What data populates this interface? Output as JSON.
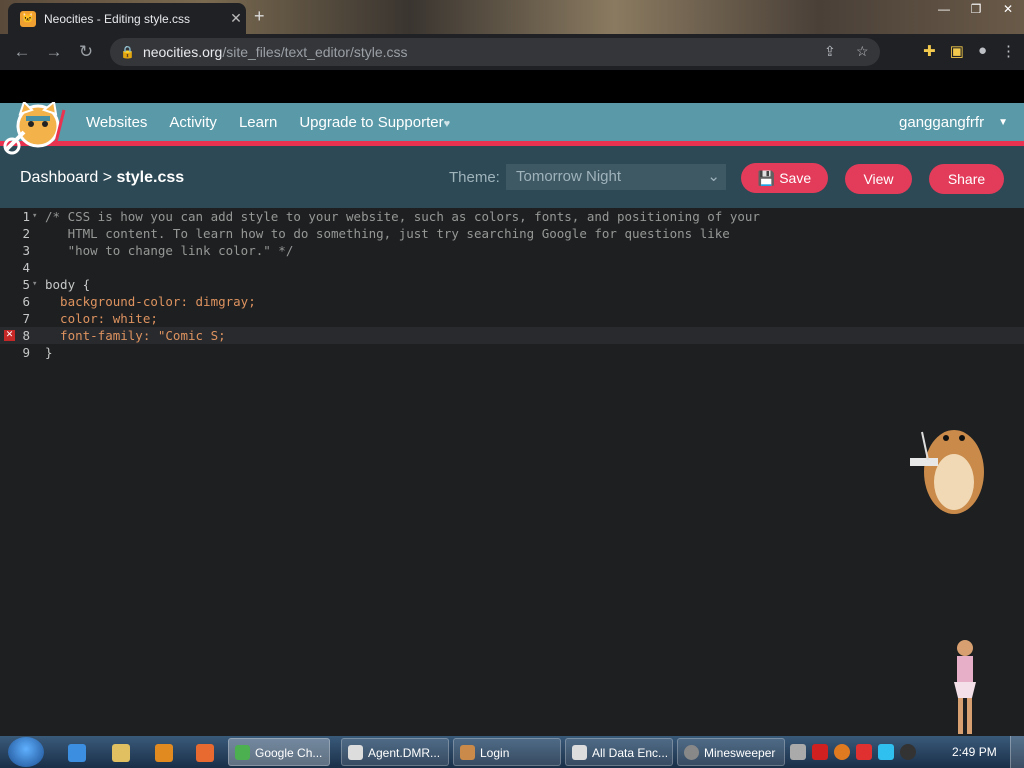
{
  "browser": {
    "tab_title": "Neocities - Editing style.css",
    "url_host": "neocities.org",
    "url_path": "/site_files/text_editor/style.css"
  },
  "site": {
    "nav": [
      "Websites",
      "Activity",
      "Learn",
      "Upgrade to Supporter"
    ],
    "username": "ganggangfrfr"
  },
  "editor": {
    "crumb_dashboard": "Dashboard",
    "crumb_sep": ">",
    "crumb_file": "style.css",
    "theme_label": "Theme:",
    "theme_value": "Tomorrow Night",
    "save_label": "Save",
    "view_label": "View",
    "share_label": "Share",
    "lines": [
      "/* CSS is how you can add style to your website, such as colors, fonts, and positioning of your",
      "   HTML content. To learn how to do something, just try searching Google for questions like",
      "   \"how to change link color.\" */",
      "",
      "body {",
      "  background-color: dimgray;",
      "  color: white;",
      "  font-family: \"Comic S;",
      "}"
    ]
  },
  "taskbar": {
    "items": [
      "Google Ch...",
      "Agent.DMR...",
      "Login",
      "All Data Enc...",
      "Minesweeper"
    ],
    "clock": "2:49 PM"
  },
  "colors": {
    "neocities_header": "#5a9aa8",
    "accent_red": "#e23c5a",
    "editor_bg": "#1d1f21"
  }
}
